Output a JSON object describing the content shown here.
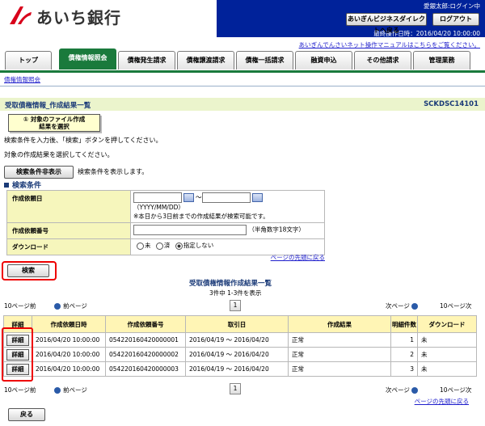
{
  "header": {
    "bank_name": "あいち銀行",
    "user": "愛銀太郎:ログイン中",
    "direct_button": "あいぎんビジネスダイレクトへ戻る",
    "logout_button": "ログアウト",
    "last_operation": "最終操作日時：2016/04/20 10:00:00",
    "manual_link": "あいぎんでんさいネット操作マニュアルはこちらをご覧ください。"
  },
  "tabs": [
    "トップ",
    "債権情報照会",
    "債権発生請求",
    "債権譲渡請求",
    "債権一括請求",
    "融資申込",
    "その他請求",
    "管理業務"
  ],
  "active_tab": "債権情報照会",
  "subnav": "債権情報照会",
  "page": {
    "title": "受取債権情報_作成結果一覧",
    "screen_id": "SCKDSC14101",
    "step_line1": "① 対象のファイル作成",
    "step_line2": "結果を選択",
    "instruction1": "検索条件を入力後、「検索」ボタンを押してください。",
    "instruction2": "対象の作成結果を選択してください。",
    "toggle_button": "検索条件非表示",
    "toggle_desc": "検索条件を表示します。",
    "section_heading": "検索条件"
  },
  "search": {
    "date_label": "作成依頼日",
    "date_sep": "〜",
    "date_format": "（YYYY/MM/DD）",
    "date_note": "※本日から3日前までの作成結果が検索可能です。",
    "number_label": "作成依頼番号",
    "number_note": "（半角数字18文字）",
    "download_label": "ダウンロード",
    "radio_unfinished": "未",
    "radio_done": "済",
    "radio_none": "指定しない",
    "selected": "指定しない",
    "page_top_link": "ページの先頭に戻る",
    "search_button": "検索"
  },
  "results": {
    "title": "受取債権情報作成結果一覧",
    "count": "3件中 1-3件を表示",
    "prev10": "10ページ前",
    "prev": "前ページ",
    "next": "次ページ",
    "next10": "10ページ次",
    "page_number": "1",
    "columns": [
      "詳細",
      "作成依頼日時",
      "作成依頼番号",
      "取引日",
      "作成結果",
      "明細件数",
      "ダウンロード"
    ],
    "detail_button": "詳細",
    "rows": [
      {
        "datetime": "2016/04/20 10:00:00",
        "number": "054220160420000001",
        "period": "2016/04/19 〜 2016/04/20",
        "result": "正常",
        "count": "1",
        "download": "未"
      },
      {
        "datetime": "2016/04/20 10:00:00",
        "number": "054220160420000002",
        "period": "2016/04/19 〜 2016/04/20",
        "result": "正常",
        "count": "2",
        "download": "未"
      },
      {
        "datetime": "2016/04/20 10:00:00",
        "number": "054220160420000003",
        "period": "2016/04/19 〜 2016/04/20",
        "result": "正常",
        "count": "3",
        "download": "未"
      }
    ],
    "page_top_link": "ページの先頭に戻る"
  },
  "footer": {
    "back_button": "戻る"
  },
  "colors": {
    "header_blue": "#00229a",
    "tab_green": "#1a7a3c",
    "title_bar": "#ebf4cc",
    "highlight_red": "#ee0000"
  }
}
